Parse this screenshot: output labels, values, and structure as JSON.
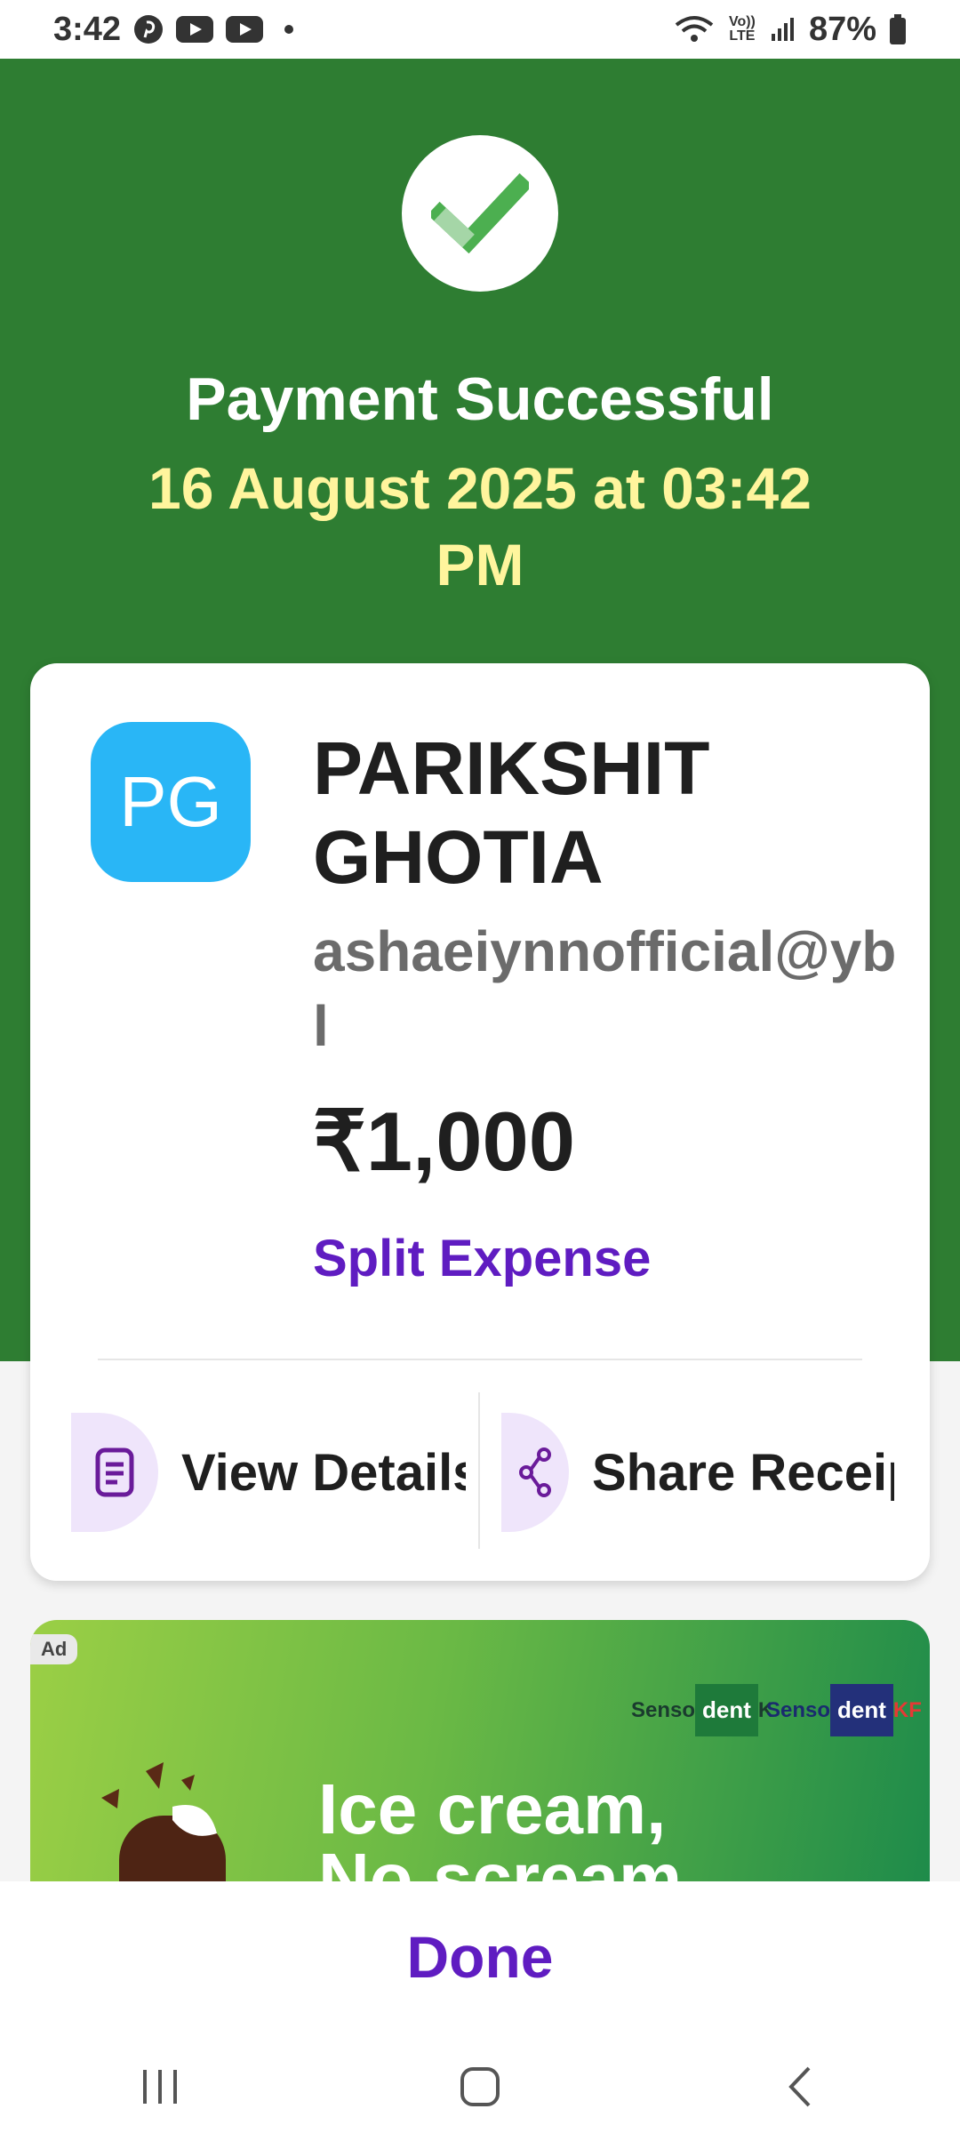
{
  "status_bar": {
    "time": "3:42",
    "battery": "87%",
    "network_label": "Vo)) LTE"
  },
  "hero": {
    "title": "Payment Successful",
    "datetime": "16 August 2025 at 03:42 PM",
    "check_icon": "check-icon",
    "bg_color": "#2e7d32"
  },
  "payee": {
    "initials": "PG",
    "name": "PARIKSHIT GHOTIA",
    "upi_id": "ashaeiynnofficial@ybl",
    "amount": "₹1,000",
    "split_label": "Split Expense"
  },
  "actions": {
    "view_details": "View Details",
    "share_receipt": "Share Receipt"
  },
  "ad": {
    "badge": "Ad",
    "brand_1_a": "Senso",
    "brand_1_b": "dent",
    "brand_1_c": "K",
    "brand_2_a": "Senso",
    "brand_2_b": "dent",
    "brand_2_c": "KF",
    "headline_1": "Ice cream,",
    "headline_2": "No scream"
  },
  "footer": {
    "done_label": "Done"
  },
  "colors": {
    "accent_purple": "#5f1cc1",
    "avatar_blue": "#29b6f6",
    "date_yellow": "#fff59d"
  }
}
